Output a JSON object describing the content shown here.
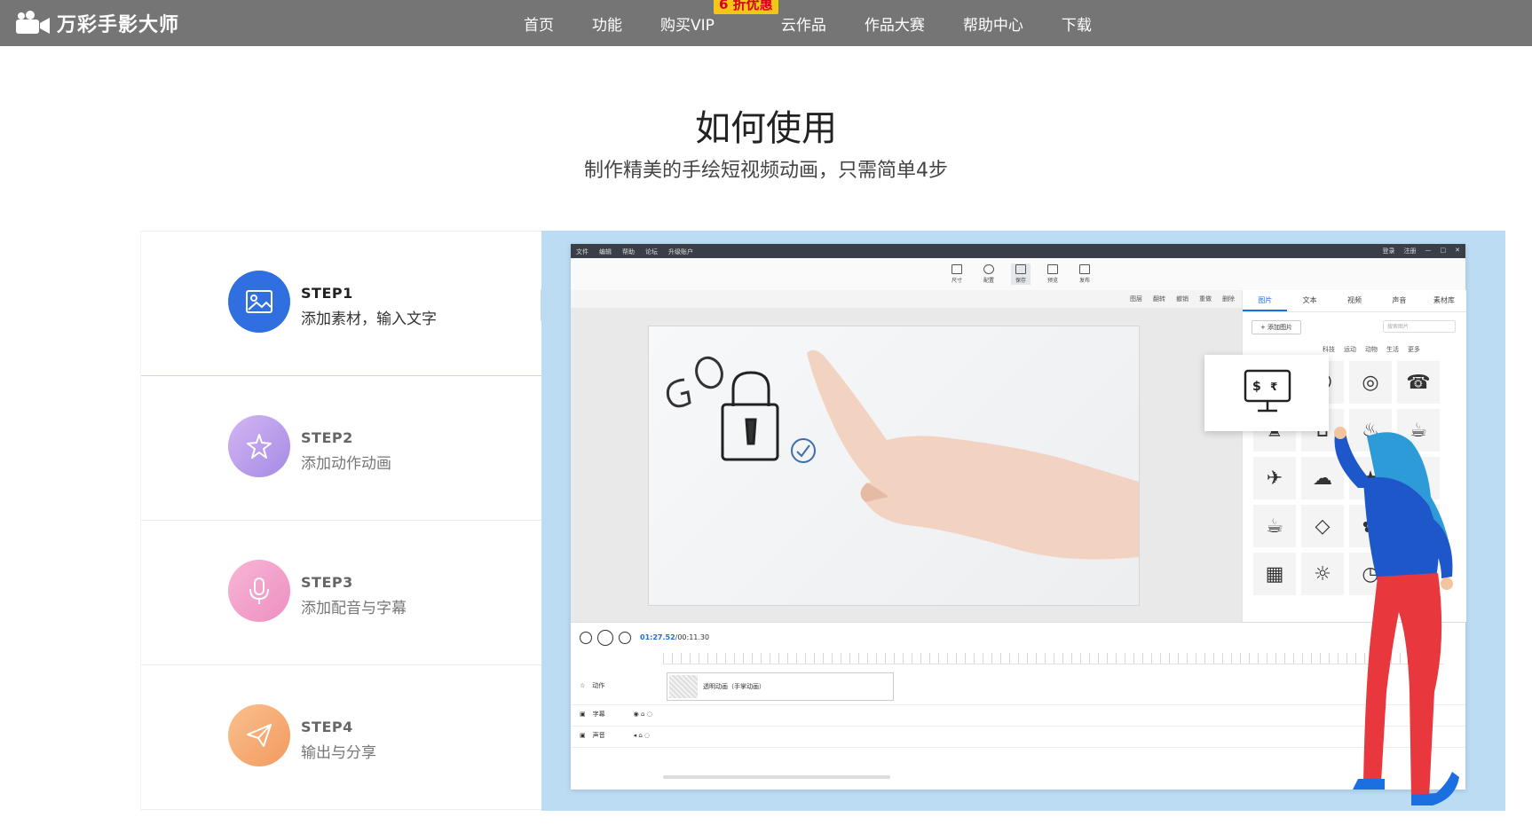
{
  "brand": {
    "name": "万彩手影大师"
  },
  "nav": {
    "items": [
      {
        "label": "首页"
      },
      {
        "label": "功能"
      },
      {
        "label": "购买VIP",
        "badge": "6 折优惠"
      },
      {
        "label": "云作品"
      },
      {
        "label": "作品大赛"
      },
      {
        "label": "帮助中心"
      },
      {
        "label": "下载"
      }
    ]
  },
  "hero": {
    "title": "如何使用",
    "subtitle": "制作精美的手绘短视频动画，只需简单4步"
  },
  "steps": [
    {
      "title": "STEP1",
      "desc": "添加素材，输入文字",
      "active": true,
      "icon": "image-icon",
      "color": "#2f6fe0"
    },
    {
      "title": "STEP2",
      "desc": "添加动作动画",
      "active": false,
      "icon": "sparkle-icon",
      "color": "#b48ee8"
    },
    {
      "title": "STEP3",
      "desc": "添加配音与字幕",
      "active": false,
      "icon": "microphone-icon",
      "color": "#f08fc0"
    },
    {
      "title": "STEP4",
      "desc": "输出与分享",
      "active": false,
      "icon": "paper-plane-icon",
      "color": "#f5a36a"
    }
  ],
  "app": {
    "menu": [
      "文件",
      "编辑",
      "帮助",
      "论坛",
      "升级账户"
    ],
    "window": [
      "登录",
      "注册",
      "—",
      "□",
      "✕"
    ],
    "tools": [
      {
        "label": "尺寸"
      },
      {
        "label": "配置"
      },
      {
        "label": "保存",
        "on": true
      },
      {
        "label": "预览"
      },
      {
        "label": "发布"
      }
    ],
    "subtools": [
      "图层",
      "翻转",
      "撤销",
      "重做",
      "删除"
    ],
    "panel_tabs": [
      {
        "label": "图片",
        "on": true
      },
      {
        "label": "文本"
      },
      {
        "label": "视频"
      },
      {
        "label": "声音"
      },
      {
        "label": "素材库"
      }
    ],
    "add_image": "+ 添加图片",
    "search_placeholder": "搜索图片",
    "categories": [
      "科技",
      "运动",
      "动物",
      "生活",
      "更多"
    ],
    "timeline": {
      "current": "01:27.52",
      "total": "/00:11.30",
      "rows": [
        {
          "label": "动作",
          "clip": "透明动画（手掌动画）"
        },
        {
          "label": "字幕"
        },
        {
          "label": "声音"
        }
      ]
    }
  },
  "colors": {
    "topbar": "#757575",
    "accent": "#1d6fe0",
    "showcase_bg": "#bcdcf4",
    "badge_bg": "#f5c518",
    "badge_text": "#d6001c"
  }
}
